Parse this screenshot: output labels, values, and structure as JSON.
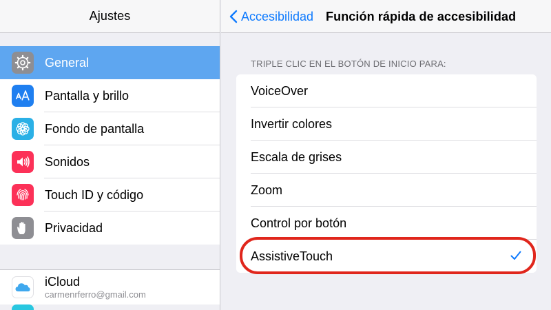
{
  "sidebar": {
    "title": "Ajustes",
    "items": [
      {
        "label": "General",
        "icon": "gear-icon"
      },
      {
        "label": "Pantalla y brillo",
        "icon": "text-size-icon"
      },
      {
        "label": "Fondo de pantalla",
        "icon": "flower-icon"
      },
      {
        "label": "Sonidos",
        "icon": "speaker-icon"
      },
      {
        "label": "Touch ID y código",
        "icon": "fingerprint-icon"
      },
      {
        "label": "Privacidad",
        "icon": "hand-icon"
      }
    ],
    "selected": "General",
    "icloud": {
      "label": "iCloud",
      "account": "carmenrferro@gmail.com",
      "icon": "cloud-icon"
    }
  },
  "nav": {
    "back_label": "Accesibilidad",
    "title": "Función rápida de accesibilidad"
  },
  "section_header": "TRIPLE CLIC EN EL BOTÓN DE INICIO PARA:",
  "options": [
    {
      "label": "VoiceOver",
      "checked": false
    },
    {
      "label": "Invertir colores",
      "checked": false
    },
    {
      "label": "Escala de grises",
      "checked": false
    },
    {
      "label": "Zoom",
      "checked": false
    },
    {
      "label": "Control por botón",
      "checked": false
    },
    {
      "label": "AssistiveTouch",
      "checked": true
    }
  ],
  "colors": {
    "accent": "#0e7afe",
    "selection": "#5ea6f0",
    "highlight": "#e0261c"
  }
}
